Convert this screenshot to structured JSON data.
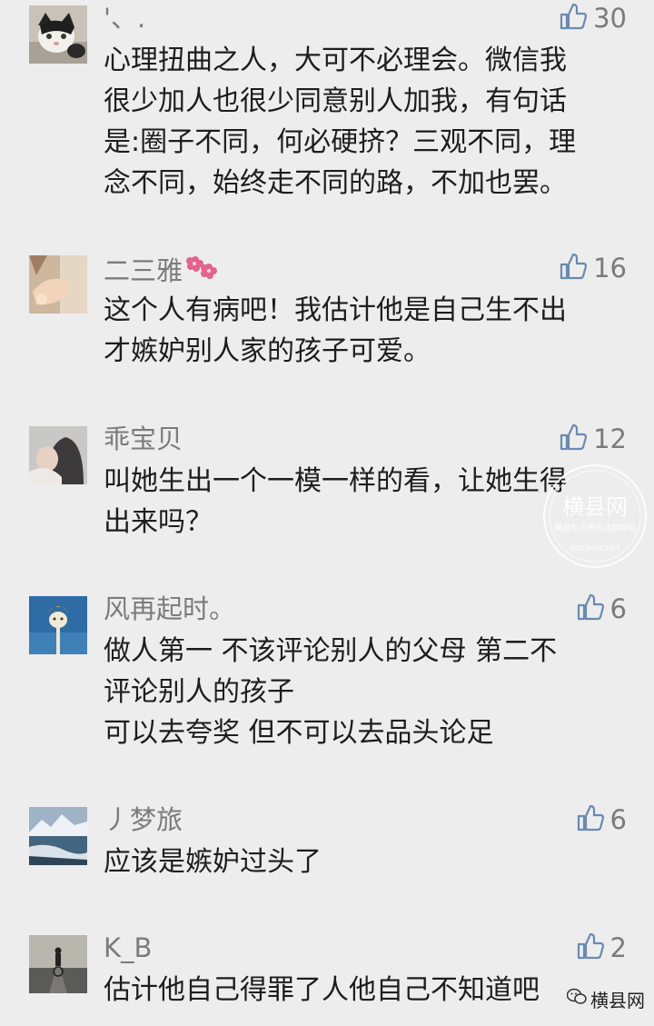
{
  "comments": [
    {
      "nickname": "'、.",
      "likes": "30",
      "avatar": "cat-avatar",
      "lines": [
        "心理扭曲之人，大可不必理会。微信我",
        "很少加人也很少同意别人加我，有句话",
        "是:圈子不同，何必硬挤？三观不同，理",
        "念不同，始终走不同的路，不加也罢。"
      ]
    },
    {
      "nickname": "二三雅",
      "likes": "16",
      "avatar": "hand-avatar",
      "lines": [
        "这个人有病吧！我估计他是自己生不出",
        "才嫉妒别人家的孩子可爱。"
      ]
    },
    {
      "nickname": "乖宝贝",
      "likes": "12",
      "avatar": "girl-avatar",
      "lines": [
        "叫她生出一个一模一样的看，让她生得",
        "出来吗？"
      ]
    },
    {
      "nickname": "风再起时。",
      "likes": "6",
      "avatar": "figure-avatar",
      "lines": [
        "做人第一 不该评论别人的父母 第二不",
        "评论别人的孩子",
        "可以去夸奖 但不可以去品头论足"
      ]
    },
    {
      "nickname": "丿梦旅",
      "likes": "6",
      "avatar": "landscape-avatar",
      "lines": [
        "应该是嫉妒过头了"
      ]
    },
    {
      "nickname": "K_B",
      "likes": "2",
      "avatar": "cyclist-avatar",
      "lines": [
        "估计他自己得罪了人他自己不知道吧"
      ]
    }
  ],
  "watermark": {
    "big": "横县网",
    "small": "横县生活资讯品牌网站",
    "url": "MOLIHUA.NET"
  },
  "footer": {
    "brand": "横县网"
  },
  "colors": {
    "background": "#ededed",
    "nickname": "#7b7b7b",
    "content": "#1d1d1d",
    "icon": "#6a8ab0"
  }
}
